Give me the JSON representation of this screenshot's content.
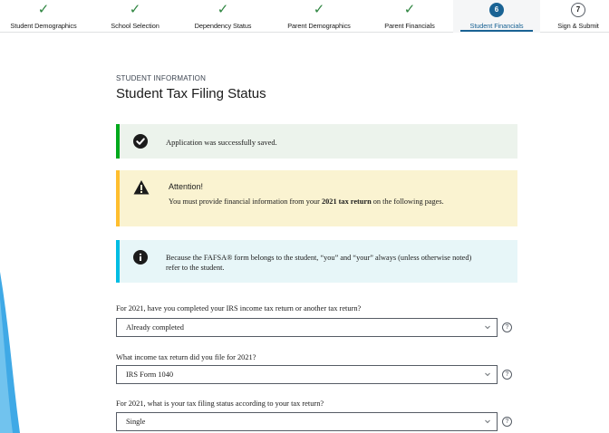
{
  "stepper": {
    "steps": [
      {
        "label": "Student Demographics",
        "state": "complete",
        "marker": "✓"
      },
      {
        "label": "School Selection",
        "state": "complete",
        "marker": "✓"
      },
      {
        "label": "Dependency Status",
        "state": "complete",
        "marker": "✓"
      },
      {
        "label": "Parent Demographics",
        "state": "complete",
        "marker": "✓"
      },
      {
        "label": "Parent Financials",
        "state": "complete",
        "marker": "✓"
      },
      {
        "label": "Student Financials",
        "state": "current",
        "marker": "6"
      },
      {
        "label": "Sign & Submit",
        "state": "upcoming",
        "marker": "7"
      }
    ]
  },
  "page": {
    "eyebrow": "STUDENT INFORMATION",
    "title": "Student Tax Filing Status"
  },
  "alerts": {
    "success": {
      "icon": "check-circle-icon",
      "text": "Application was successfully saved."
    },
    "warning": {
      "icon": "warning-triangle-icon",
      "heading": "Attention!",
      "text_before": "You must provide financial information from your ",
      "text_bold": "2021 tax return",
      "text_after": " on the following pages."
    },
    "info": {
      "icon": "info-circle-icon",
      "text": "Because the FAFSA® form belongs to the student, “you” and “your” always (unless otherwise noted) refer to the student."
    }
  },
  "questions": [
    {
      "label": "For 2021, have you completed your IRS income tax return or another tax return?",
      "value": "Already completed"
    },
    {
      "label": "What income tax return did you file for 2021?",
      "value": "IRS Form 1040"
    },
    {
      "label": "For 2021, what is your tax filing status according to your tax return?",
      "value": "Single"
    }
  ],
  "help_glyph": "?",
  "colors": {
    "complete": "#2e8540",
    "current": "#1a6394",
    "success_bar": "#00a91c",
    "warning_bar": "#ffbe2e",
    "info_bar": "#00bde3"
  }
}
